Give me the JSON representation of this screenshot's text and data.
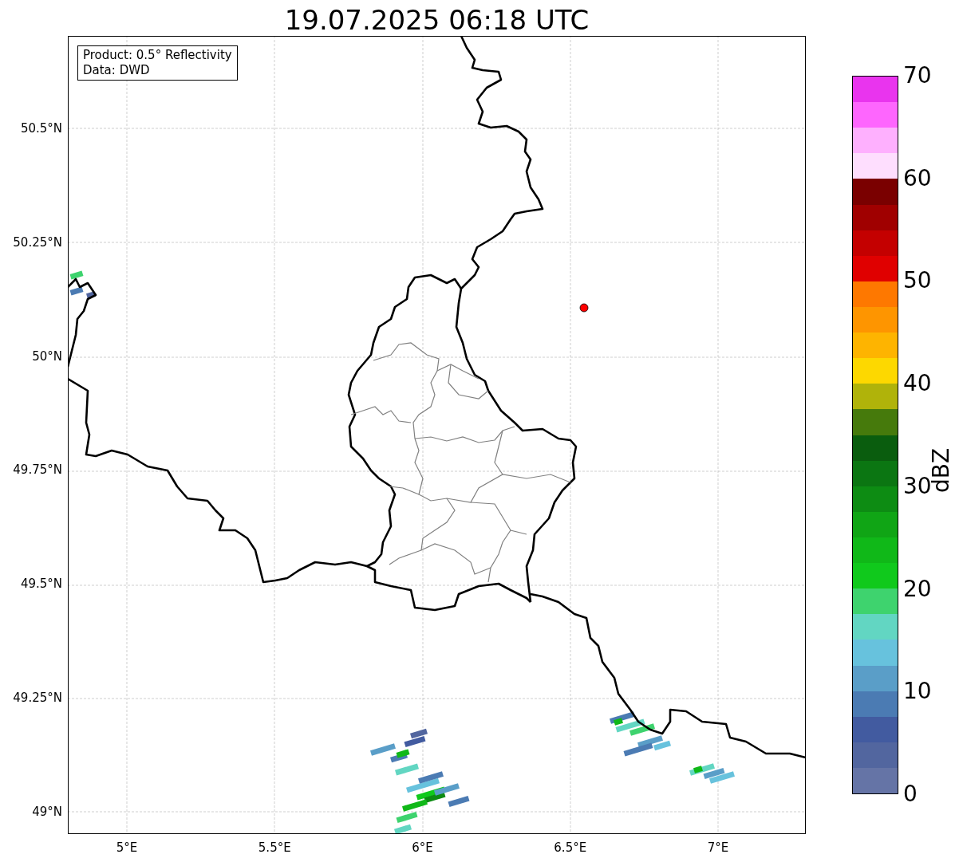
{
  "title": "19.07.2025 06:18 UTC",
  "info_box": [
    "Product: 0.5° Reflectivity",
    "Data: DWD"
  ],
  "map": {
    "x_ticks": [
      "5°E",
      "5.5°E",
      "6°E",
      "6.5°E",
      "7°E"
    ],
    "y_ticks": [
      "50.5°N",
      "50.25°N",
      "50°N",
      "49.75°N",
      "49.5°N",
      "49.25°N",
      "49°N"
    ]
  },
  "colorbar": {
    "label": "dBZ",
    "ticks": [
      "70",
      "60",
      "50",
      "40",
      "30",
      "20",
      "10",
      "0"
    ],
    "bands": [
      {
        "color": "#e934ee"
      },
      {
        "color": "#fe66fe"
      },
      {
        "color": "#feb0fe"
      },
      {
        "color": "#fedefe"
      },
      {
        "color": "#7a0000"
      },
      {
        "color": "#a00000"
      },
      {
        "color": "#c40000"
      },
      {
        "color": "#e00000"
      },
      {
        "color": "#fe7800"
      },
      {
        "color": "#fe9500"
      },
      {
        "color": "#feb400"
      },
      {
        "color": "#fdd800"
      },
      {
        "color": "#b0b30a"
      },
      {
        "color": "#467a0c"
      },
      {
        "color": "#0a5d0e"
      },
      {
        "color": "#0b7612"
      },
      {
        "color": "#0d8c13"
      },
      {
        "color": "#10a515"
      },
      {
        "color": "#10b818"
      },
      {
        "color": "#10c91c"
      },
      {
        "color": "#3ed36e"
      },
      {
        "color": "#62d6c2"
      },
      {
        "color": "#67c2dd"
      },
      {
        "color": "#5a9ec8"
      },
      {
        "color": "#4b7bb3"
      },
      {
        "color": "#425ba0"
      },
      {
        "color": "#52669f"
      },
      {
        "color": "#6574a6"
      }
    ]
  }
}
